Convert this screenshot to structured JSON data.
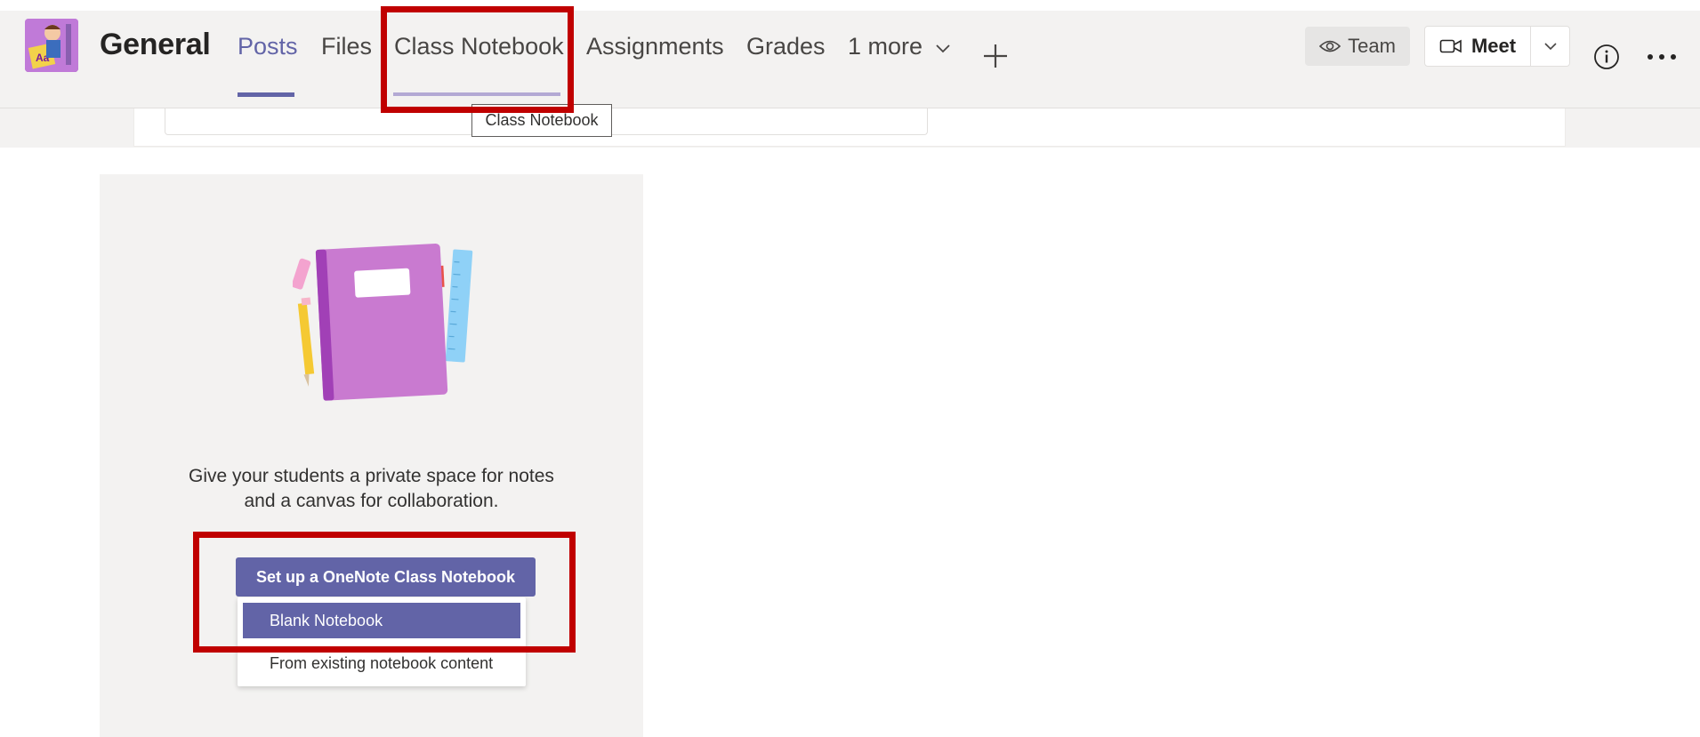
{
  "header": {
    "channel_name": "General",
    "tabs": [
      {
        "label": "Posts",
        "active": true
      },
      {
        "label": "Files",
        "active": false
      },
      {
        "label": "Class Notebook",
        "active": false
      },
      {
        "label": "Assignments",
        "active": false
      },
      {
        "label": "Grades",
        "active": false
      },
      {
        "label": "1 more",
        "active": false
      }
    ],
    "team_label": "Team",
    "meet_label": "Meet",
    "tooltip": "Class Notebook"
  },
  "notebook_panel": {
    "description_line1": "Give your students a private space for notes",
    "description_line2": "and a canvas for collaboration.",
    "setup_button": "Set up a OneNote Class Notebook",
    "menu_items": [
      {
        "label": "Blank Notebook",
        "selected": true
      },
      {
        "label": "From existing notebook content",
        "selected": false
      }
    ]
  },
  "colors": {
    "accent": "#6264a7",
    "highlight": "#c00000",
    "header_bg": "#f3f2f1",
    "panel_bg": "#f3f2f1"
  },
  "icons": {
    "team": "eye-icon",
    "meet": "video-camera-icon",
    "meet_dropdown": "chevron-down-icon",
    "info": "info-icon",
    "more": "more-options-icon",
    "add_tab": "plus-icon",
    "more_tabs": "chevron-down-icon"
  }
}
